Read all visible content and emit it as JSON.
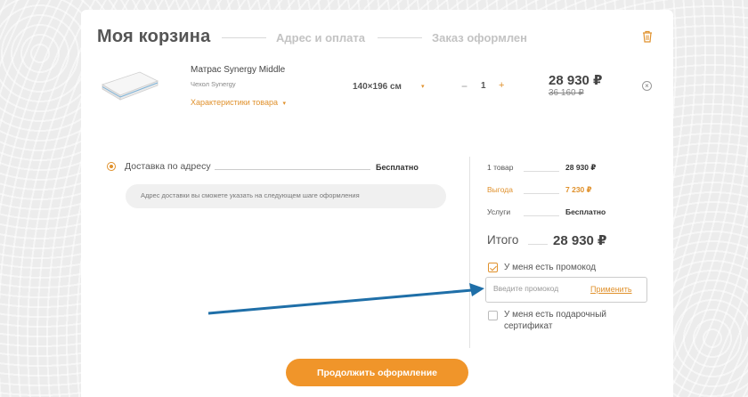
{
  "header": {
    "title": "Моя корзина",
    "steps": [
      "Адрес и оплата",
      "Заказ оформлен"
    ]
  },
  "product": {
    "name": "Матрас Synergy Middle",
    "cover": "Чехол Synergy",
    "characteristics_link": "Характеристики товара",
    "dropdown_arrow": "▾",
    "size": "140×196 см",
    "quantity_minus": "−",
    "quantity": "1",
    "quantity_plus": "+",
    "price": "28 930 ₽",
    "old_price": "36 160 ₽",
    "remove_icon_glyph": "×"
  },
  "delivery": {
    "option_label": "Доставка по адресу",
    "price": "Бесплатно",
    "note": "Адрес доставки вы сможете указать на следующем шаге оформления"
  },
  "summary": {
    "items_label": "1 товар",
    "items_value": "28 930 ₽",
    "discount_label": "Выгода",
    "discount_value": "7 230 ₽",
    "services_label": "Услуги",
    "services_value": "Бесплатно",
    "total_label": "Итого",
    "total_value": "28 930 ₽"
  },
  "promo": {
    "checkbox_label": "У меня есть промокод",
    "checked": true,
    "placeholder": "Введите промокод",
    "apply_label": "Применить"
  },
  "gift": {
    "checkbox_label_line1": "У меня есть подарочный",
    "checkbox_label_line2": "сертификат",
    "checked": false
  },
  "continue_button": "Продолжить оформление",
  "colors": {
    "accent": "#e0912c",
    "button": "#f0952a",
    "annotation_arrow": "#1f6fa8"
  }
}
